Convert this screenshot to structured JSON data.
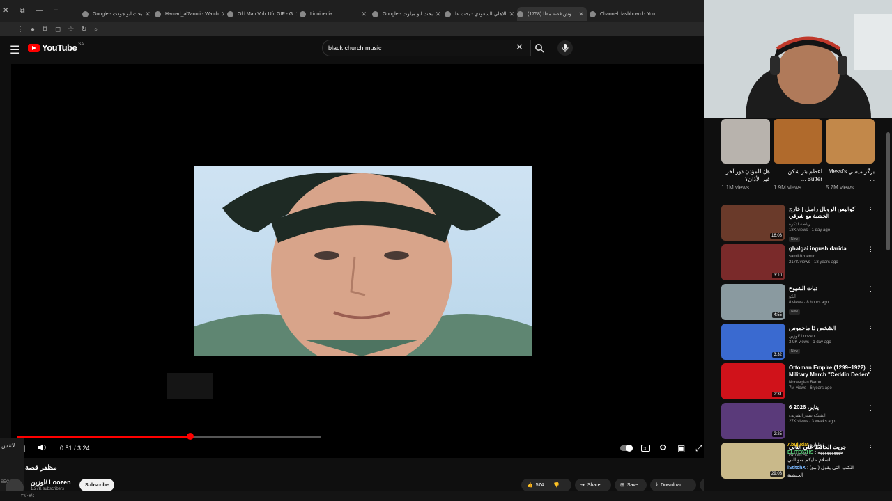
{
  "browser": {
    "tabs": [
      {
        "label": "Google - بحث ابو جودت",
        "active": false
      },
      {
        "label": "Hamad_al7anoti - Watch",
        "active": false
      },
      {
        "label": "Old Man Volx Ufc GIF - G",
        "active": false
      },
      {
        "label": "Liquipedia",
        "active": false
      },
      {
        "label": "Google - بحث ابو ميلوت",
        "active": false
      },
      {
        "label": "الاهلي السعودي - بحث عا",
        "active": false
      },
      {
        "label": "(1768) وش قصة مطا...",
        "active": true
      },
      {
        "label": "Channel dashboard - You",
        "active": false
      }
    ]
  },
  "header": {
    "logo_text": "YouTube",
    "country_code": "SA",
    "search_value": "black church music"
  },
  "player": {
    "current_time": "0:51",
    "duration": "3:24",
    "time_separator": " / ",
    "progress_fraction": 0.25,
    "buffered_fraction": 0.438
  },
  "video": {
    "title": "مظفر قصة",
    "channel": "لوزين/ Loozen",
    "subscribers": "1.27K subscribers",
    "subscribe_label": "Subscribe",
    "likes": "574",
    "share_label": "Share",
    "save_label": "Save",
    "download_label": "Download"
  },
  "shorts": [
    {
      "title": "هل للمؤذن دور آخر غير الأذان؟",
      "views": "1.1M views",
      "color": "#b8b3ad"
    },
    {
      "title": "اعظم بتر شكن Butter ...",
      "views": "1.9M views",
      "color": "#b06a2c"
    },
    {
      "title": "برگر ميسي Messi's ...",
      "views": "5.7M views",
      "color": "#c2884a"
    }
  ],
  "related": [
    {
      "title": "كواليس الروبال رامبل | خارج الخشبة مع شرقي",
      "channel": "رياضة لدكرة",
      "stats": "18K views · 1 day ago",
      "duration": "16:03",
      "badge": "New",
      "color": "#6a3a2a"
    },
    {
      "title": "ghalgai ingush darida",
      "channel": "şamil özdemir",
      "stats": "217K views · 18 years ago",
      "duration": "3:10",
      "badge": "",
      "color": "#7a2a2a"
    },
    {
      "title": "ذبات الشيوخ",
      "channel": "أنكو",
      "stats": "8 views · 8 hours ago",
      "duration": "4:55",
      "badge": "New",
      "color": "#8a9aa0"
    },
    {
      "title": "الشخص ذا ماحموس",
      "channel": "لوزين/ Loozen",
      "stats": "3.9K views · 1 day ago",
      "duration": "3:32",
      "badge": "New",
      "color": "#3a6ad0"
    },
    {
      "title": "Ottoman Empire (1299–1922) Military March \"Ceddin Deden\"",
      "channel": "Norwegian Baron",
      "stats": "7M views · 6 years ago",
      "duration": "2:31",
      "badge": "",
      "color": "#d0121a"
    },
    {
      "title": "6 يناير، 2026",
      "channel": "الشبكة بيشر الشريف",
      "stats": "27K views · 3 weeks ago",
      "duration": "2:25",
      "badge": "",
      "color": "#5a3a7a"
    },
    {
      "title": "جريت الحافظ على الثاني",
      "channel": "Ayman Az",
      "stats": "",
      "duration": "29:03",
      "badge": "",
      "color": "#c9b98a"
    }
  ],
  "chat": [
    {
      "user": "Abujudat",
      "text": "طنازه :",
      "color": "#f5c518"
    },
    {
      "user": "ELITE87HS",
      "text": ": ههههههههههه",
      "color": "#5ad07a"
    },
    {
      "user": "",
      "text": "السلام عليكم متو التي",
      "color": "#ffffff"
    },
    {
      "user": "iStitchX",
      "text": ": (مع ) الكتب التي يقول",
      "color": "#7ab8ff"
    },
    {
      "user": "",
      "text": "الحيشية",
      "color": "#ffffff"
    }
  ],
  "overlay": {
    "left_text": "لاتنس",
    "second_label": "SECOND",
    "date_text": "٢٧/٠٧/٤"
  },
  "colors": {
    "accent": "#ff0000",
    "bg": "#0f0f0f"
  }
}
